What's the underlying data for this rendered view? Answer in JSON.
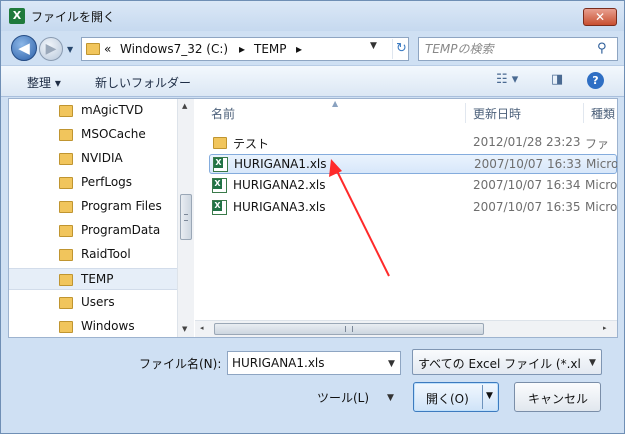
{
  "window": {
    "title": "ファイルを開く",
    "app_icon_glyph": "X",
    "close_glyph": "✕"
  },
  "nav": {
    "back_glyph": "◀",
    "forward_glyph": "▶",
    "history_glyph": "▼",
    "address_parts": [
      "«",
      "Windows7_32 (C:)",
      "▸",
      "TEMP",
      "▸"
    ],
    "address_dropdown_glyph": "▼",
    "refresh_glyph": "↻",
    "search_placeholder": "TEMPの検索",
    "search_glyph": "⚲"
  },
  "toolbar": {
    "organize_label": "整理 ▾",
    "new_folder_label": "新しいフォルダー",
    "view_glyph": "☷ ▾",
    "preview_pane_glyph": "◨",
    "help_glyph": "?"
  },
  "tree": {
    "items": [
      {
        "label": "mAgicTVD",
        "selected": false
      },
      {
        "label": "MSOCache",
        "selected": false
      },
      {
        "label": "NVIDIA",
        "selected": false
      },
      {
        "label": "PerfLogs",
        "selected": false
      },
      {
        "label": "Program Files",
        "selected": false
      },
      {
        "label": "ProgramData",
        "selected": false
      },
      {
        "label": "RaidTool",
        "selected": false
      },
      {
        "label": "TEMP",
        "selected": true
      },
      {
        "label": "Users",
        "selected": false
      },
      {
        "label": "Windows",
        "selected": false
      }
    ],
    "scroll_up_glyph": "▲",
    "scroll_down_glyph": "▼"
  },
  "files": {
    "columns": {
      "name": "名前",
      "date": "更新日時",
      "type": "種類"
    },
    "rows": [
      {
        "name": "テスト",
        "date": "2012/01/28 23:23",
        "type": "ファ",
        "kind": "folder",
        "highlighted": false
      },
      {
        "name": "HURIGANA1.xls",
        "date": "2007/10/07 16:33",
        "type": "Micro",
        "kind": "xls",
        "highlighted": true
      },
      {
        "name": "HURIGANA2.xls",
        "date": "2007/10/07 16:34",
        "type": "Micro",
        "kind": "xls",
        "highlighted": false
      },
      {
        "name": "HURIGANA3.xls",
        "date": "2007/10/07 16:35",
        "type": "Micro",
        "kind": "xls",
        "highlighted": false
      }
    ],
    "scroll_left_glyph": "◂",
    "scroll_right_glyph": "▸",
    "sort_glyph": "▲"
  },
  "footer": {
    "filename_label": "ファイル名(N):",
    "filename_value": "HURIGANA1.xls",
    "filetype_value": "すべての Excel ファイル (*.xl",
    "dropdown_glyph": "▼",
    "tools_label": "ツール(L)",
    "open_label": "開く(O)",
    "cancel_label": "キャンセル"
  },
  "colors": {
    "annotation_arrow": "#ff2a2a",
    "chrome": "#cfe0f3",
    "selection": "#d7e7fa"
  }
}
